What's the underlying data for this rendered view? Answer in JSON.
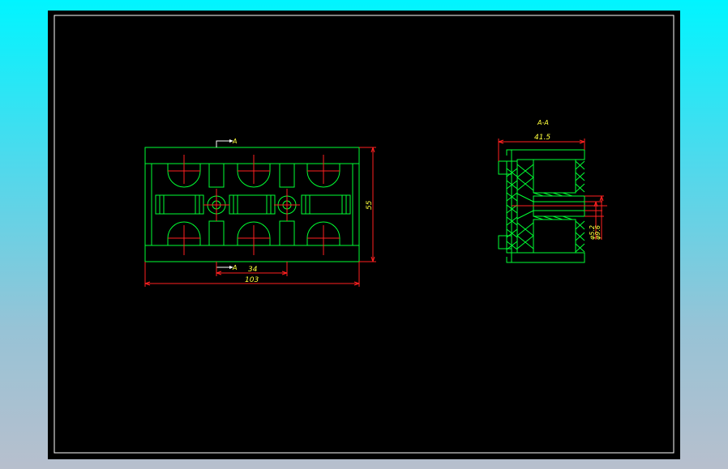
{
  "colors": {
    "background_top": "#00f5ff",
    "background_bottom": "#b7bfcd",
    "sheet": "#000000",
    "frame": "#ffffff",
    "outline": "#00ff33",
    "centerline": "#ff2020",
    "dimension": "#ff2020",
    "text": "#ffff3c"
  },
  "front_view": {
    "section_marker_top": "A",
    "section_marker_bottom": "A",
    "dim_width_total": "103",
    "dim_spacing": "34",
    "dim_height": "55"
  },
  "section_view": {
    "title": "A-A",
    "dim_depth": "41.5",
    "dim_inner_diameter": "φ5.2",
    "dim_outer_diameter": "φ9.6"
  }
}
